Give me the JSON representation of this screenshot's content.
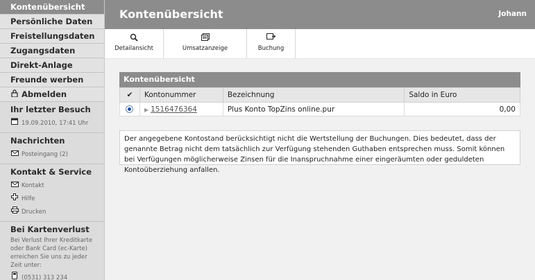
{
  "sidebar": {
    "nav": [
      {
        "label": "Kontenübersicht"
      },
      {
        "label": "Persönliche Daten"
      },
      {
        "label": "Freistellungsdaten"
      },
      {
        "label": "Zugangsdaten"
      },
      {
        "label": "Direkt-Anlage"
      },
      {
        "label": "Freunde werben"
      },
      {
        "label": "Abmelden",
        "icon": "lock-icon"
      }
    ],
    "last_visit": {
      "title": "Ihr letzter Besuch",
      "value": "19.09.2010, 17:41 Uhr",
      "icon": "calendar-icon"
    },
    "messages": {
      "title": "Nachrichten",
      "inbox": "Posteingang (2)",
      "icon": "envelope-icon"
    },
    "contact": {
      "title": "Kontakt & Service",
      "items": [
        {
          "label": "Kontakt",
          "icon": "envelope-icon"
        },
        {
          "label": "Hilfe",
          "icon": "help-cross-icon"
        },
        {
          "label": "Drucken",
          "icon": "printer-icon"
        }
      ]
    },
    "card_loss": {
      "title": "Bei Kartenverlust",
      "text": "Bei Verlust Ihrer Kreditkarte oder Bank Card (ec-Karte) erreichen Sie uns zu jeder Zeit unter:",
      "phone": "(0531) 313 234",
      "icon": "phone-icon"
    }
  },
  "header": {
    "title": "Kontenübersicht",
    "user": "Johann"
  },
  "toolbar": {
    "items": [
      {
        "label": "Detailansicht",
        "icon": "magnifier-icon"
      },
      {
        "label": "Umsatzanzeige",
        "icon": "list-icon"
      },
      {
        "label": "Buchung",
        "icon": "transfer-icon"
      }
    ]
  },
  "accounts": {
    "title": "Kontenübersicht",
    "columns": {
      "check": "✔",
      "number": "Kontonummer",
      "name": "Bezeichnung",
      "balance": "Saldo in Euro"
    },
    "rows": [
      {
        "number": "1516476364",
        "name": "Plus Konto TopZins online.pur",
        "balance": "0,00",
        "selected": true
      }
    ]
  },
  "notice": "Der angegebene Kontostand berücksichtigt nicht die Wertstellung der Buchungen. Dies bedeutet, dass der genannte Betrag nicht dem tatsächlich zur Verfügung stehenden Guthaben entsprechen muss. Somit können bei Verfügungen möglicherweise Zinsen für die Inanspruchnahme einer eingeräumten oder geduldeten Kontoüberziehung anfallen.",
  "colors": {
    "header_bg": "#8c8c8c",
    "sidebar_bg": "#dcdcdc",
    "main_bg": "#f1f1f1",
    "radio": "#1f4fa0"
  }
}
